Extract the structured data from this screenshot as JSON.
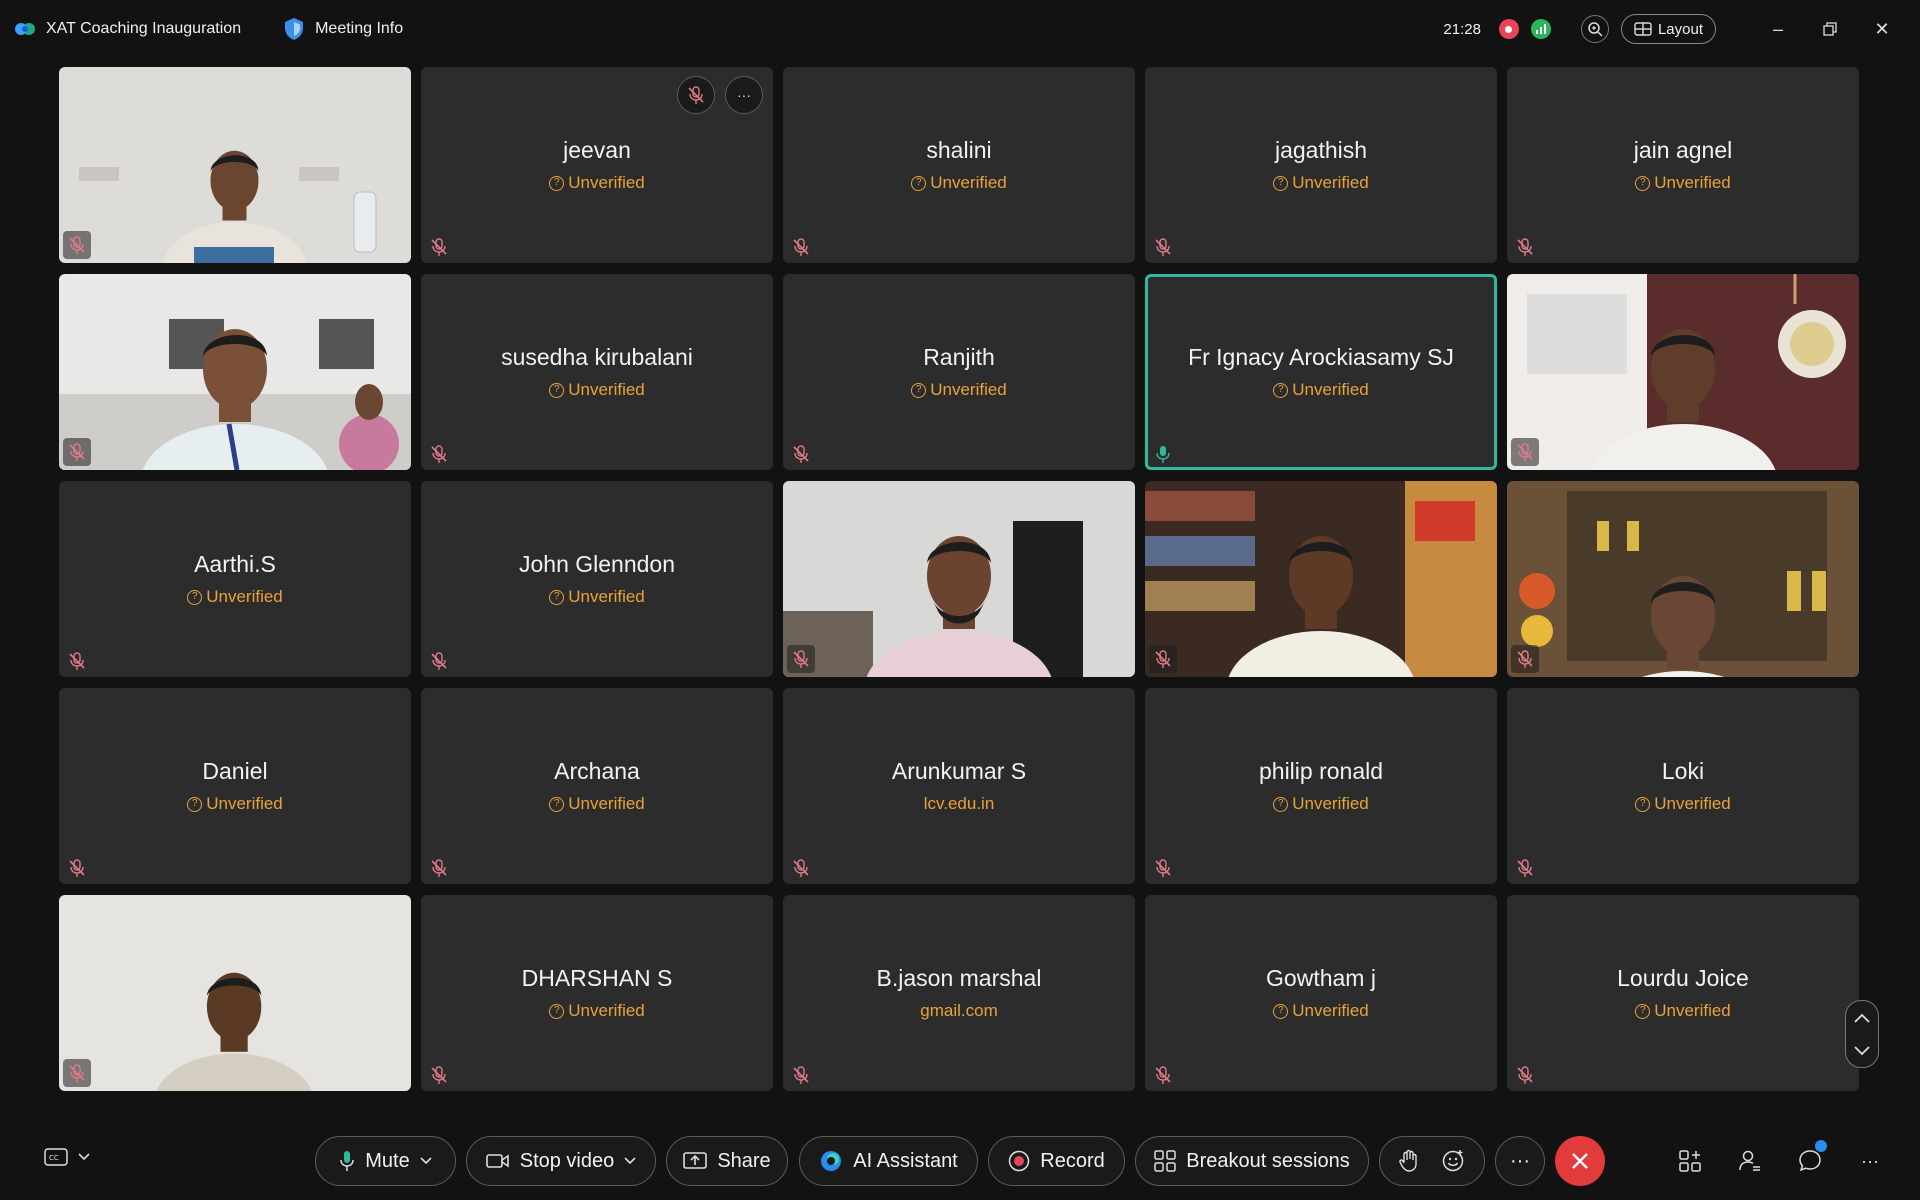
{
  "titlebar": {
    "meeting_title": "XAT Coaching Inauguration",
    "info_label": "Meeting Info",
    "clock": "21:28",
    "layout_label": "Layout"
  },
  "participants": [
    {
      "type": "video",
      "scene": "white-wall"
    },
    {
      "type": "name",
      "name": "jeevan",
      "status": "Unverified"
    },
    {
      "type": "name",
      "name": "shalini",
      "status": "Unverified"
    },
    {
      "type": "name",
      "name": "jagathish",
      "status": "Unverified"
    },
    {
      "type": "name",
      "name": "jain agnel",
      "status": "Unverified"
    },
    {
      "type": "video",
      "scene": "classroom"
    },
    {
      "type": "name",
      "name": "susedha kirubalani",
      "status": "Unverified"
    },
    {
      "type": "name",
      "name": "Ranjith",
      "status": "Unverified"
    },
    {
      "type": "name",
      "name": "Fr Ignacy Arockiasamy SJ",
      "status": "Unverified",
      "active": true
    },
    {
      "type": "video",
      "scene": "office-red"
    },
    {
      "type": "name",
      "name": "Aarthi.S",
      "status": "Unverified"
    },
    {
      "type": "name",
      "name": "John Glenndon",
      "status": "Unverified"
    },
    {
      "type": "video",
      "scene": "office-white"
    },
    {
      "type": "video",
      "scene": "bookshelf"
    },
    {
      "type": "video",
      "scene": "trophies"
    },
    {
      "type": "name",
      "name": "Daniel",
      "status": "Unverified"
    },
    {
      "type": "name",
      "name": "Archana",
      "status": "Unverified"
    },
    {
      "type": "name",
      "name": "Arunkumar S",
      "status": "lcv.edu.in",
      "domain": true
    },
    {
      "type": "name",
      "name": "philip ronald",
      "status": "Unverified"
    },
    {
      "type": "name",
      "name": "Loki",
      "status": "Unverified"
    },
    {
      "type": "video",
      "scene": "plain-wall"
    },
    {
      "type": "name",
      "name": "DHARSHAN S",
      "status": "Unverified"
    },
    {
      "type": "name",
      "name": "B.jason marshal",
      "status": "gmail.com",
      "domain": true
    },
    {
      "type": "name",
      "name": "Gowtham j",
      "status": "Unverified"
    },
    {
      "type": "name",
      "name": "Lourdu  Joice",
      "status": "Unverified"
    }
  ],
  "toolbar": {
    "mute_label": "Mute",
    "stop_video_label": "Stop video",
    "share_label": "Share",
    "ai_assistant_label": "AI Assistant",
    "record_label": "Record",
    "breakout_label": "Breakout sessions"
  },
  "colors": {
    "accent_active": "#2fb89b",
    "unverified": "#e8a23a",
    "end_call": "#e23b3b",
    "muted_icon": "#e07a86"
  }
}
